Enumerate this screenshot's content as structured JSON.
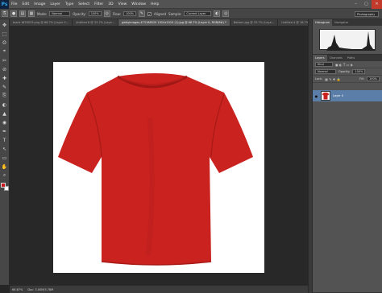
{
  "app": {
    "logo": "Ps"
  },
  "menu": [
    "File",
    "Edit",
    "Image",
    "Layer",
    "Type",
    "Select",
    "Filter",
    "3D",
    "View",
    "Window",
    "Help"
  ],
  "window_controls": {
    "minimize": "–",
    "maximize": "▢",
    "close": "✕"
  },
  "options": {
    "mode_label": "Mode:",
    "mode_value": "Normal",
    "opacity_label": "Opacity:",
    "opacity_value": "100%",
    "flow_label": "Flow:",
    "flow_value": "100%",
    "aligned_label": "Aligned",
    "aligned_check": "✓",
    "sample_label": "Sample:",
    "sample_value": "Current Layer",
    "workspace": "Photography"
  },
  "tabs": [
    {
      "label": "blank t876533.png @ 66.7% (Layer 0..."
    },
    {
      "label": "Untitled 6 @ 33.7% (Laye..."
    },
    {
      "label": "gettyimages-473188529 1024x1024 (1).jpg @ 66.7% (Layer 0, RGB/8#) *"
    },
    {
      "label": "Bottom.jpg @ 33.7% (Laye..."
    },
    {
      "label": "Untitled 4 @ 16.7% (Laye..."
    }
  ],
  "tools": [
    "✥",
    "⬚",
    "ʘ",
    "⌖",
    "✂",
    "⊘",
    "✚",
    "✎",
    "⎘",
    "◐",
    "▲",
    "◉",
    "✒",
    "T",
    "↖",
    "▭",
    "✋",
    "⌕"
  ],
  "swatches": {
    "foreground": "#c8181e",
    "background": "#ffffff"
  },
  "colors": {
    "shirt": "#c9221f",
    "layer_selected": "#5b7ea8",
    "close_button": "#c23a2b"
  },
  "status": {
    "zoom": "66.67%",
    "doc": "Doc: 3.00M/3.78M"
  },
  "panels": {
    "top_tabs": [
      "Histogram",
      "Navigator"
    ],
    "layer_tabs": [
      "Layers",
      "Channels",
      "Paths"
    ],
    "kind_label": "Kind",
    "blend_mode": "Normal",
    "opacity_label": "Opacity:",
    "opacity_value": "100%",
    "lock_label": "Lock:",
    "fill_label": "Fill:",
    "fill_value": "100%",
    "layer_name": "Layer 0",
    "visibility_icon": "●"
  },
  "footer_icons": [
    "⛓",
    "fx",
    "◐",
    "▣",
    "▭",
    "🗑"
  ]
}
